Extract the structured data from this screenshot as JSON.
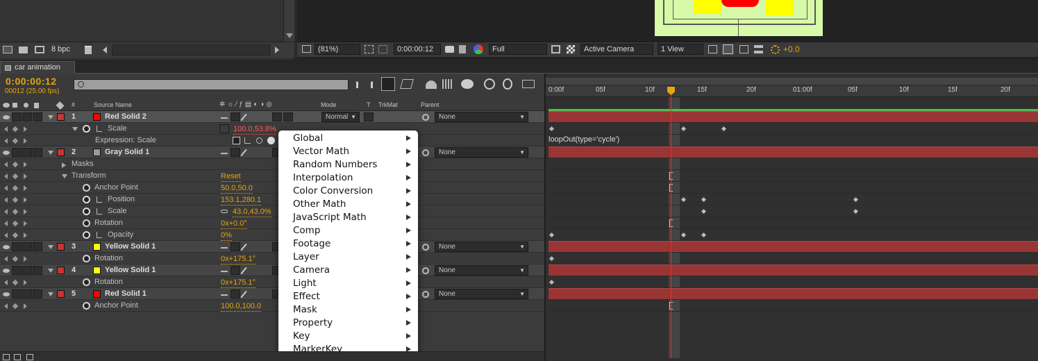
{
  "project": {
    "bpc_label": "8 bpc"
  },
  "viewer_bar": {
    "zoom": "(81%)",
    "timecode": "0:00:00:12",
    "resolution": "Full",
    "camera": "Active Camera",
    "views": "1 View",
    "exposure": "+0.0"
  },
  "tab": {
    "label": "car animation"
  },
  "timeline": {
    "current_time": "0:00:00:12",
    "frame_fps": "00012 (25.00 fps)",
    "columns": {
      "num": "#",
      "source_name": "Source Name",
      "mode": "Mode",
      "t": "T",
      "trkmat": "TrkMat",
      "parent": "Parent"
    },
    "ruler_ticks": [
      "0:00f",
      "05f",
      "10f",
      "15f",
      "20f",
      "01:00f",
      "05f",
      "10f",
      "15f",
      "20f"
    ]
  },
  "rows": [
    {
      "type": "layer",
      "num": "1",
      "name": "Red Solid 2",
      "color": "#ff0000",
      "mode": "Normal",
      "parent": "None",
      "selected": true
    },
    {
      "type": "prop",
      "name": "Scale",
      "value": "100.0,53.8%",
      "red": true
    },
    {
      "type": "expr",
      "name": "Expression: Scale",
      "expression": "loopOut(type='cycle')"
    },
    {
      "type": "layer",
      "num": "2",
      "name": "Gray Solid 1",
      "color": "#9a9a9a",
      "parent": "None"
    },
    {
      "type": "group",
      "name": "Masks"
    },
    {
      "type": "group",
      "name": "Transform",
      "value": "Reset"
    },
    {
      "type": "prop",
      "name": "Anchor Point",
      "value": "50.0,50.0"
    },
    {
      "type": "prop",
      "name": "Position",
      "value": "153.1,280.1"
    },
    {
      "type": "prop",
      "name": "Scale",
      "value": "43.0,43.0%"
    },
    {
      "type": "prop",
      "name": "Rotation",
      "value": "0x+0.0°"
    },
    {
      "type": "prop",
      "name": "Opacity",
      "value": "0%"
    },
    {
      "type": "layer",
      "num": "3",
      "name": "Yellow Solid 1",
      "color": "#ffff00",
      "parent": "None"
    },
    {
      "type": "prop",
      "name": "Rotation",
      "value": "0x+175.1°"
    },
    {
      "type": "layer",
      "num": "4",
      "name": "Yellow Solid 1",
      "color": "#ffff00",
      "parent": "None"
    },
    {
      "type": "prop",
      "name": "Rotation",
      "value": "0x+175.1°"
    },
    {
      "type": "layer",
      "num": "5",
      "name": "Red Solid 1",
      "color": "#ff0000",
      "parent": "None"
    },
    {
      "type": "prop",
      "name": "Anchor Point",
      "value": "100.0,100.0"
    }
  ],
  "menu": {
    "items": [
      "Global",
      "Vector Math",
      "Random Numbers",
      "Interpolation",
      "Color Conversion",
      "Other Math",
      "JavaScript Math",
      "Comp",
      "Footage",
      "Layer",
      "Camera",
      "Light",
      "Effect",
      "Mask",
      "Property",
      "Key",
      "MarkerKey"
    ]
  }
}
